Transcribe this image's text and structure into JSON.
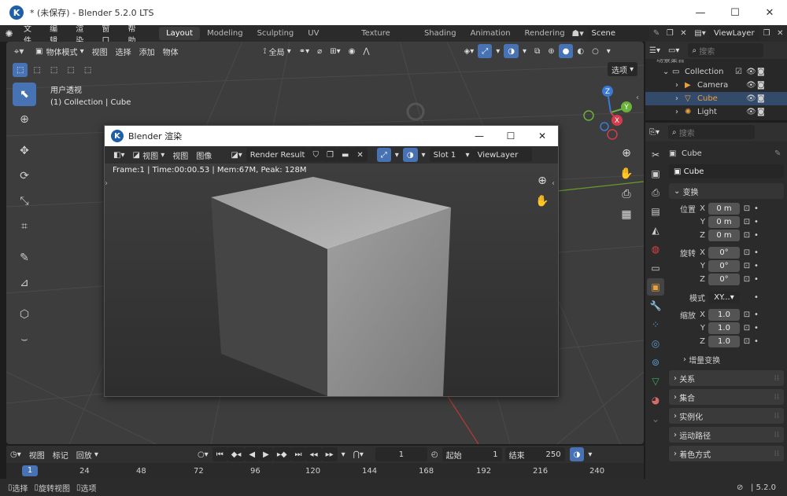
{
  "window": {
    "title": "* (未保存) - Blender 5.2.0 LTS",
    "logo": "K"
  },
  "menu": {
    "items": [
      "文件",
      "编辑",
      "渲染",
      "窗口",
      "帮助"
    ],
    "workspaces": [
      "Layout",
      "Modeling",
      "Sculpting",
      "UV Editing",
      "Texture Paint",
      "Shading",
      "Animation",
      "Rendering"
    ],
    "active_workspace": "Layout",
    "scene": "Scene",
    "view_layer": "ViewLayer"
  },
  "viewport": {
    "mode": "物体模式",
    "menus": [
      "视图",
      "选择",
      "添加",
      "物体"
    ],
    "transform_space": "全局",
    "options": "选项",
    "info_line1": "用户透视",
    "info_line2": "(1) Collection | Cube",
    "gizmo": {
      "x": "X",
      "y": "Y",
      "z": "Z"
    }
  },
  "render_window": {
    "title": "Blender 渲染",
    "menus": [
      "视图",
      "视图",
      "图像"
    ],
    "image": "Render Result",
    "slot": "Slot 1",
    "layer": "ViewLayer",
    "stats": "Frame:1 | Time:00:00.53 | Mem:67M, Peak: 128M"
  },
  "outliner": {
    "header": "场景集合",
    "search_placeholder": "搜索",
    "items": [
      {
        "name": "Collection"
      },
      {
        "name": "Camera"
      },
      {
        "name": "Cube"
      },
      {
        "name": "Light"
      }
    ]
  },
  "properties": {
    "search_placeholder": "搜索",
    "object_name": "Cube",
    "object_field": "Cube",
    "transform_header": "变换",
    "location": {
      "label": "位置",
      "x": "0 m",
      "y": "0 m",
      "z": "0 m"
    },
    "rotation": {
      "label": "旋转",
      "x": "0°",
      "y": "0°",
      "z": "0°"
    },
    "mode": {
      "label": "模式",
      "value": "XY..."
    },
    "scale": {
      "label": "缩放",
      "x": "1.0",
      "y": "1.0",
      "z": "1.0"
    },
    "axes": {
      "x": "X",
      "y": "Y",
      "z": "Z"
    },
    "delta": "增量变换",
    "sections": [
      "关系",
      "集合",
      "实例化",
      "运动路径",
      "着色方式"
    ]
  },
  "timeline": {
    "menus": [
      "视图",
      "标记",
      "回放"
    ],
    "current_frame": "1",
    "start_label": "起始",
    "start": "1",
    "end_label": "结束",
    "end": "250",
    "ruler": [
      "1",
      "24",
      "48",
      "72",
      "96",
      "120",
      "144",
      "168",
      "192",
      "216",
      "240"
    ]
  },
  "status": {
    "select": "选择",
    "rotate": "旋转视图",
    "options": "选项",
    "version": "5.2.0"
  },
  "colors": {
    "accent": "#4772b3",
    "active_object": "#e8a040",
    "x_axis": "#d43c4c",
    "y_axis": "#6ab23a",
    "z_axis": "#3a7ad4"
  }
}
